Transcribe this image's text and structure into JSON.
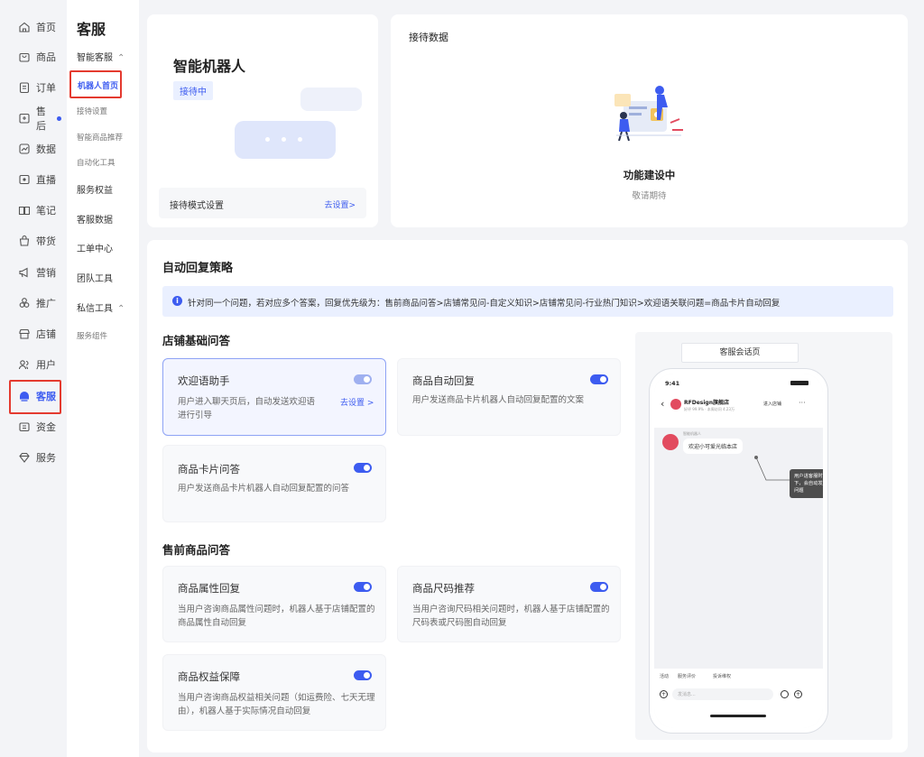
{
  "nav": {
    "items": [
      {
        "key": "home",
        "label": "首页",
        "icon": "home-icon"
      },
      {
        "key": "goods",
        "label": "商品",
        "icon": "bag-icon"
      },
      {
        "key": "orders",
        "label": "订单",
        "icon": "order-icon"
      },
      {
        "key": "aftersale",
        "label": "售后",
        "icon": "aftersale-icon"
      },
      {
        "key": "data",
        "label": "数据",
        "icon": "chart-icon"
      },
      {
        "key": "live",
        "label": "直播",
        "icon": "live-icon"
      },
      {
        "key": "notes",
        "label": "笔记",
        "icon": "notes-icon"
      },
      {
        "key": "sell",
        "label": "带货",
        "icon": "goods-bag-icon"
      },
      {
        "key": "marketing",
        "label": "营销",
        "icon": "megaphone-icon"
      },
      {
        "key": "promo",
        "label": "推广",
        "icon": "promotion-icon"
      },
      {
        "key": "store",
        "label": "店铺",
        "icon": "store-icon"
      },
      {
        "key": "users",
        "label": "用户",
        "icon": "users-icon"
      },
      {
        "key": "service",
        "label": "客服",
        "icon": "service-icon"
      },
      {
        "key": "funds",
        "label": "资金",
        "icon": "wallet-icon"
      },
      {
        "key": "services",
        "label": "服务",
        "icon": "diamond-icon"
      }
    ],
    "active_index": 12
  },
  "subnav": {
    "title": "客服",
    "group1": "智能客服",
    "robot_home": "机器人首页",
    "reception_settings": "接待设置",
    "smart_recommend": "智能商品推荐",
    "automation": "自动化工具",
    "service_rights": "服务权益",
    "service_data": "客服数据",
    "ticket_center": "工单中心",
    "team_tools": "团队工具",
    "dm_tools": "私信工具",
    "service_components": "服务组件"
  },
  "robot_card": {
    "title": "智能机器人",
    "status": "接待中",
    "mode_label": "接待模式设置",
    "mode_link": "去设置>"
  },
  "reception_card": {
    "title": "接待数据",
    "building": "功能建设中",
    "stay_tuned": "敬请期待"
  },
  "strategy": {
    "title": "自动回复策略",
    "notice": "针对同一个问题，若对应多个答案，回复优先级为：售前商品问答>店铺常见问-自定义知识>店铺常见问-行业热门知识>欢迎语关联问题=商品卡片自动回复",
    "section_basic": "店铺基础问答",
    "section_presale": "售前商品问答",
    "cards": {
      "welcome": {
        "title": "欢迎语助手",
        "desc": "用户进入聊天页后，自动发送欢迎语进行引导",
        "link": "去设置 >"
      },
      "auto_reply": {
        "title": "商品自动回复",
        "desc": "用户发送商品卡片机器人自动回复配置的文案"
      },
      "card_qa": {
        "title": "商品卡片问答",
        "desc": "用户发送商品卡片机器人自动回复配置的问答"
      },
      "attr": {
        "title": "商品属性回复",
        "desc": "当用户咨询商品属性问题时，机器人基于店铺配置的商品属性自动回复"
      },
      "size": {
        "title": "商品尺码推荐",
        "desc": "当用户咨询尺码相关问题时，机器人基于店铺配置的尺码表或尺码图自动回复"
      },
      "rights": {
        "title": "商品权益保障",
        "desc": "当用户咨询商品权益相关问题（如运费险、七天无理由），机器人基于实际情况自动回复"
      }
    }
  },
  "preview": {
    "label": "客服会话页",
    "time": "9:41",
    "shop_name": "RFDesign旗舰店",
    "shop_sub": "好评 99.9% · 本周访问 4.23万",
    "enter_shop": "进入店铺",
    "bot_name": "智能机器人",
    "welcome_msg": "欢迎小可爱光临本店",
    "tooltip": "用户进客服时，满足条件的情况下，会自动发送欢迎语和关联常见问题",
    "quick1": "活动",
    "quick2": "服务评价",
    "quick3": "投诉维权",
    "input_placeholder": "发消息..."
  },
  "colors": {
    "accent": "#3d5cf0",
    "highlight": "#e43a2f"
  }
}
